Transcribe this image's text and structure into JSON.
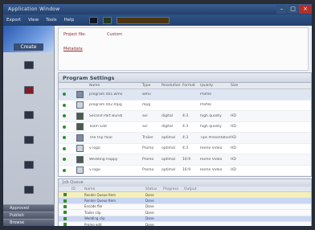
{
  "window": {
    "title": "Application Window"
  },
  "menu": [
    "Export",
    "View",
    "Tools",
    "Help"
  ],
  "sidebar": {
    "header_label": "Create",
    "items": [
      {
        "icon": "monitor-icon",
        "label": ""
      },
      {
        "icon": "record-icon",
        "label": ""
      },
      {
        "icon": "film-icon",
        "label": ""
      },
      {
        "icon": "capture-icon",
        "label": ""
      },
      {
        "icon": "media-icon",
        "label": ""
      },
      {
        "icon": "layout-icon",
        "label": ""
      }
    ],
    "bottom": [
      "Approved",
      "Publish",
      "Browse"
    ]
  },
  "info": {
    "line1": "Project file:",
    "line1b": "Custom",
    "line2": "Metadata"
  },
  "panel": {
    "title": "Program Settings",
    "columns": [
      "",
      "",
      "Name",
      "Type",
      "Resolution",
      "Format",
      "Quality",
      "Size"
    ],
    "rows": [
      {
        "thumb": "gray",
        "name": "program 001.wmv",
        "type": "wmv",
        "res": "",
        "fmt": "",
        "quality": "Profile",
        "size": ""
      },
      {
        "thumb": "white",
        "name": "program 002.mpg",
        "type": "mpg",
        "res": "",
        "fmt": "",
        "quality": "Profile",
        "size": ""
      },
      {
        "thumb": "img",
        "name": "Second Part Bundl",
        "type": "avi",
        "res": "digital",
        "fmt": "4:3",
        "quality": "high quality",
        "size": "HD"
      },
      {
        "thumb": "img",
        "name": "Team Edit",
        "type": "avi",
        "res": "digital",
        "fmt": "4:3",
        "quality": "high quality",
        "size": "HD"
      },
      {
        "thumb": "gray",
        "name": "The trip final",
        "type": "Trailer",
        "res": "optimal",
        "fmt": "4:3",
        "quality": "Tips Presentation",
        "size": "HD"
      },
      {
        "thumb": "white",
        "name": "v logo",
        "type": "Promo",
        "res": "optimal",
        "fmt": "4:3",
        "quality": "Home Video",
        "size": "HD"
      },
      {
        "thumb": "img",
        "name": "Wedding Happy",
        "type": "Promo",
        "res": "optimal",
        "fmt": "16:9",
        "quality": "Home Video",
        "size": "HD"
      },
      {
        "thumb": "white",
        "name": "v logo",
        "type": "Promo",
        "res": "optimal",
        "fmt": "16:9",
        "quality": "Home Video",
        "size": "HD"
      }
    ]
  },
  "lower": {
    "title": "Job Queue",
    "columns": [
      "",
      "ID",
      "Name",
      "",
      "Status",
      "Progress",
      "Output",
      ""
    ],
    "rows": [
      {
        "style": "y",
        "id": "",
        "name": "Render Queue Item",
        "st": "Done",
        "prog": "",
        "out": ""
      },
      {
        "style": "b",
        "id": "",
        "name": "Render Queue Item",
        "st": "Done",
        "prog": "",
        "out": ""
      },
      {
        "style": "w",
        "id": "",
        "name": "Encode file",
        "st": "Done",
        "prog": "",
        "out": ""
      },
      {
        "style": "w",
        "id": "",
        "name": "Trailer clip",
        "st": "Done",
        "prog": "",
        "out": ""
      },
      {
        "style": "b",
        "id": "",
        "name": "Wedding clip",
        "st": "Done",
        "prog": "",
        "out": ""
      },
      {
        "style": "w",
        "id": "",
        "name": "Promo edit",
        "st": "Done",
        "prog": "",
        "out": ""
      },
      {
        "style": "w",
        "id": "",
        "name": "Trip video",
        "st": "Done",
        "prog": "",
        "out": ""
      },
      {
        "style": "w",
        "id": "",
        "name": "Finished item",
        "st": "Done",
        "prog": "",
        "out": ""
      }
    ]
  }
}
